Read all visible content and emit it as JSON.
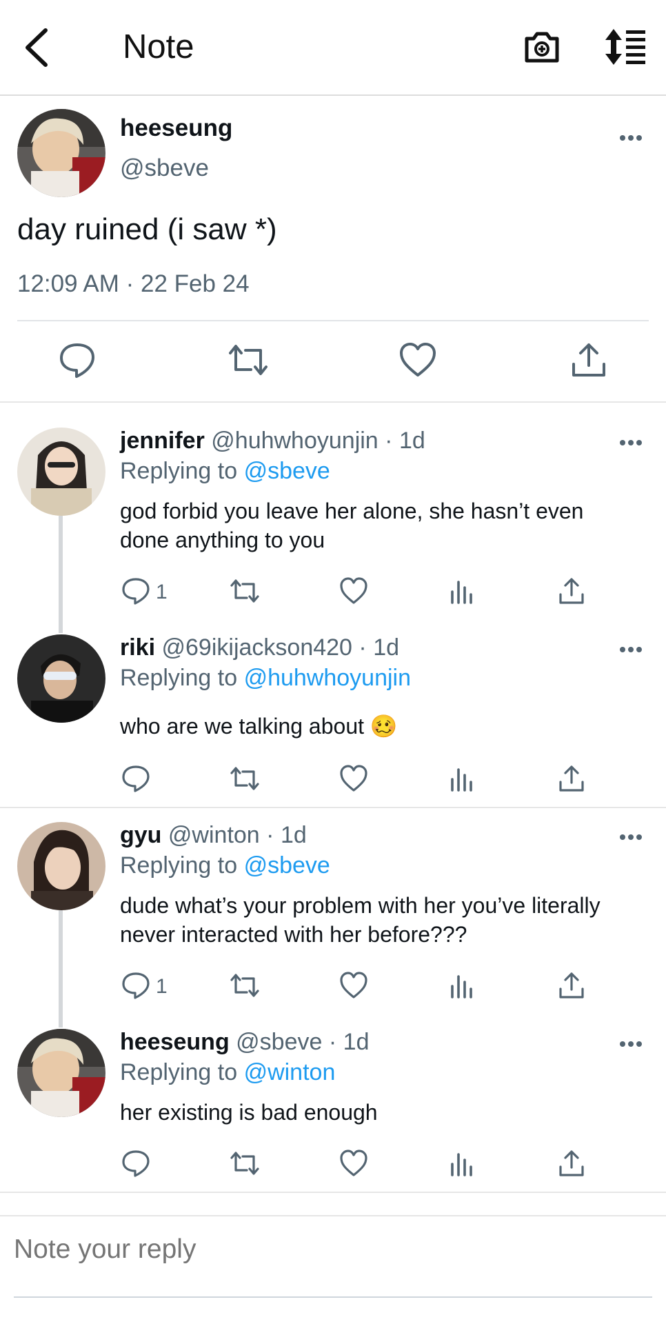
{
  "header": {
    "title": "Note",
    "back_icon": "chevron-left-icon",
    "camera_icon": "camera-icon",
    "sort_icon": "sort-icon"
  },
  "main_tweet": {
    "name": "heeseung",
    "handle": "@sbeve",
    "text": "day ruined (i saw *)",
    "timestamp": "12:09 AM · 22 Feb 24"
  },
  "replies": [
    {
      "name": "jennifer",
      "handle": "@huhwhoyunjin",
      "separator": "·",
      "time": "1d",
      "replying_prefix": "Replying to",
      "replying_to": "@sbeve",
      "text": "god forbid you leave her alone, she hasn’t even done anything to you",
      "reply_count": "1"
    },
    {
      "name": "riki",
      "handle": "@69ikijackson420",
      "separator": "·",
      "time": "1d",
      "replying_prefix": "Replying to",
      "replying_to": "@huhwhoyunjin",
      "text": "who are we talking about 🥴",
      "reply_count": ""
    },
    {
      "name": "gyu",
      "handle": "@winton",
      "separator": "·",
      "time": "1d",
      "replying_prefix": "Replying to",
      "replying_to": "@sbeve",
      "text": "dude what’s your problem with her you’ve literally never interacted with her before???",
      "reply_count": "1"
    },
    {
      "name": "heeseung",
      "handle": "@sbeve",
      "separator": "·",
      "time": "1d",
      "replying_prefix": "Replying to",
      "replying_to": "@winton",
      "text": "her existing is bad enough",
      "reply_count": ""
    }
  ],
  "reply_box": {
    "placeholder": "Note your reply"
  },
  "colors": {
    "link": "#1d9bf0",
    "secondary_text": "#536471",
    "thread_line": "#d4d7da"
  }
}
